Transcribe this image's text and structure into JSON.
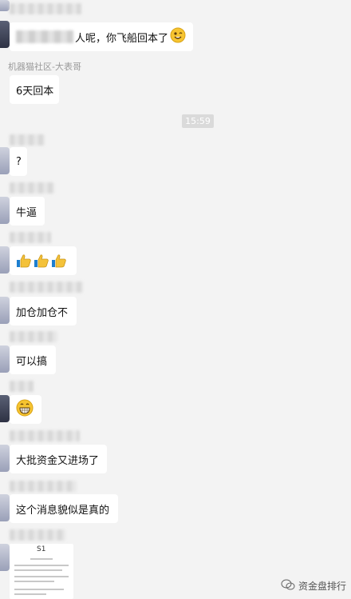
{
  "chat": {
    "messages": [
      {
        "id": "m1",
        "text": "人呢，你飞船回本了",
        "has_redaction": true,
        "emoji": "grin-face"
      },
      {
        "id": "m2",
        "sender": "机器猫社区-大表哥",
        "text": "6天回本"
      },
      {
        "id": "m3",
        "text": "?"
      },
      {
        "id": "m4",
        "text": "牛逼"
      },
      {
        "id": "m5",
        "emoji": "thumbs-up x3"
      },
      {
        "id": "m6",
        "text": "加仓加仓不"
      },
      {
        "id": "m7",
        "text": "可以搞"
      },
      {
        "id": "m8",
        "emoji": "big-grin-face"
      },
      {
        "id": "m9",
        "text": "大批资金又进场了"
      },
      {
        "id": "m10",
        "text": "这个消息貌似是真的"
      }
    ],
    "timestamp": "15:59",
    "doc_card_title": "S1"
  },
  "watermark": {
    "text": "资金盘排行"
  },
  "colors": {
    "background": "#f3f3f3",
    "bubble": "#ffffff",
    "time_chip": "#dadada",
    "sender_name": "#9a9a9a"
  }
}
